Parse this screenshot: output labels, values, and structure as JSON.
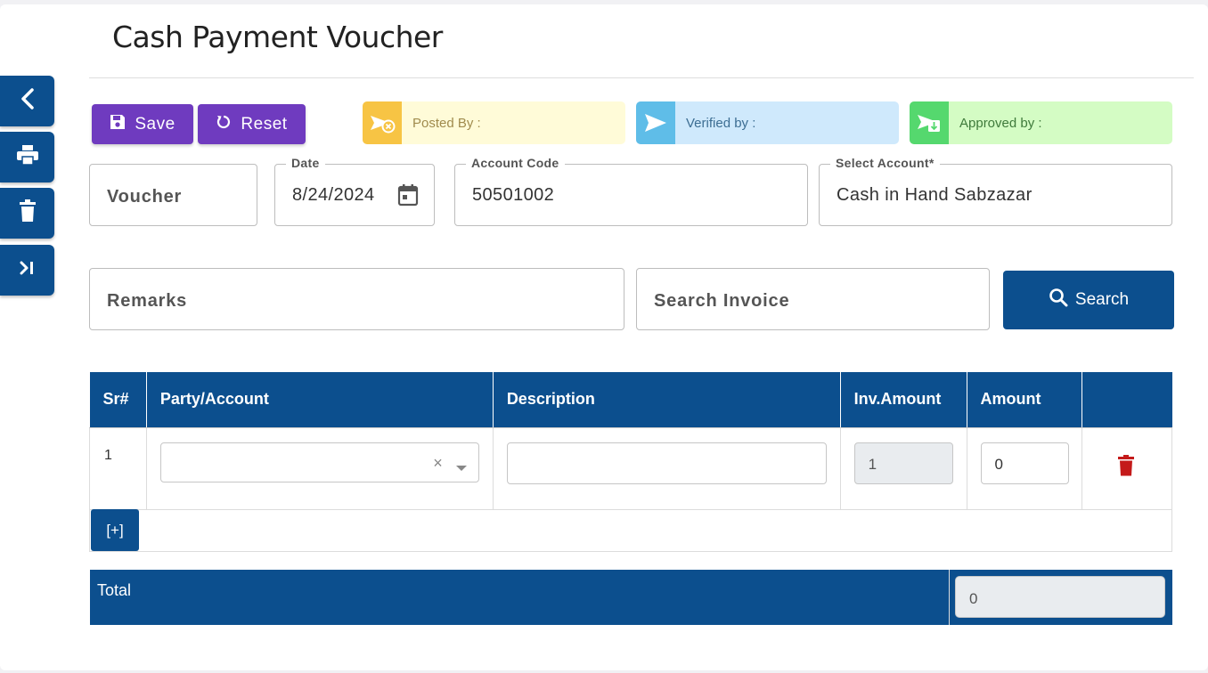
{
  "page": {
    "title": "Cash Payment Voucher"
  },
  "side_nav": [
    {
      "icon": "chevron-left-icon"
    },
    {
      "icon": "print-icon"
    },
    {
      "icon": "trash-icon"
    },
    {
      "icon": "skip-to-end-icon"
    }
  ],
  "toolbar": {
    "save_label": "Save",
    "reset_label": "Reset"
  },
  "status": {
    "posted_label": "Posted By :",
    "verified_label": "Verified by :",
    "approved_label": "Approved by :"
  },
  "form": {
    "voucher_placeholder": "Voucher",
    "date_label": "Date",
    "date_value": "8/24/2024",
    "account_code_label": "Account Code",
    "account_code_value": "50501002",
    "select_account_label": "Select Account*",
    "select_account_value": "Cash in Hand Sabzazar",
    "remarks_placeholder": "Remarks",
    "search_invoice_placeholder": "Search Invoice",
    "search_button": "Search"
  },
  "table": {
    "headers": [
      "Sr#",
      "Party/Account",
      "Description",
      "Inv.Amount",
      "Amount",
      ""
    ],
    "rows": [
      {
        "sr": "1",
        "party": "",
        "description": "",
        "inv_amount": "1",
        "amount": "0"
      }
    ],
    "add_row_label": "[+]",
    "select_clear": "×"
  },
  "total": {
    "label": "Total",
    "value": "0"
  },
  "colors": {
    "primary": "#0c4f8e",
    "purple": "#6f3bbf",
    "posted_bg": "#fffbd8",
    "posted_icon_bg": "#f7c444",
    "verified_bg": "#cfe9fc",
    "verified_icon_bg": "#5fbde8",
    "approved_bg": "#d4fcc4",
    "approved_icon_bg": "#55d86e",
    "delete": "#c41a1a"
  }
}
